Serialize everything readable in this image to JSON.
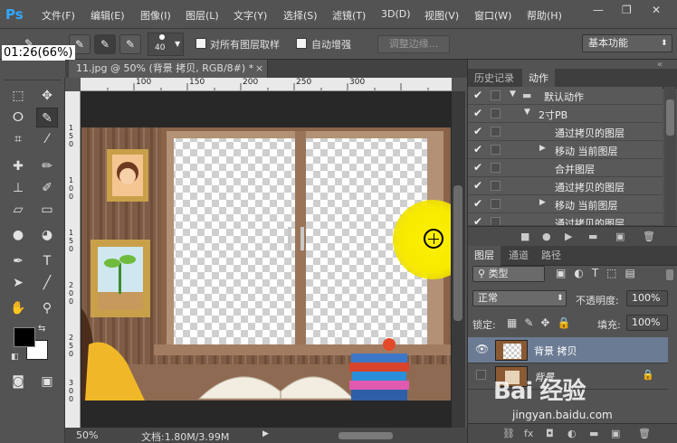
{
  "app": {
    "logo": "Ps"
  },
  "menu": [
    "文件(F)",
    "编辑(E)",
    "图像(I)",
    "图层(L)",
    "文字(Y)",
    "选择(S)",
    "滤镜(T)",
    "3D(D)",
    "视图(V)",
    "窗口(W)",
    "帮助(H)"
  ],
  "window_controls": {
    "minimize": "—",
    "restore": "❐",
    "close": "✕"
  },
  "options": {
    "brush_size": "40",
    "sample_all_layers_label": "对所有图层取样",
    "auto_enhance_label": "自动增强",
    "refine_edge_label": "调整边缘...",
    "workspace": "基本功能"
  },
  "timer": "01:26(66%)",
  "document": {
    "tab_label": "11.jpg @ 50% (背景 拷贝, RGB/8#) *",
    "close": "×",
    "ruler_top_labels": [
      "100",
      "150",
      "200",
      "250",
      "300"
    ],
    "ruler_left_labels": [
      "1",
      "5",
      "0",
      "1",
      "0",
      "0",
      "1",
      "5",
      "0",
      "2",
      "0",
      "0",
      "2",
      "5",
      "0",
      "3",
      "0",
      "0",
      "3",
      "5",
      "0"
    ]
  },
  "status": {
    "zoom": "50%",
    "doc_info": "文档:1.80M/3.99M",
    "arrow": "▶"
  },
  "panels": {
    "top_tabs": [
      "历史记录",
      "动作"
    ],
    "actions": [
      {
        "label": "默认动作",
        "level": 0,
        "expand": "▼",
        "folder": true
      },
      {
        "label": "2寸PB",
        "level": 1,
        "expand": "▼",
        "folder": false
      },
      {
        "label": "通过拷贝的图层",
        "level": 2,
        "expand": "",
        "folder": false
      },
      {
        "label": "移动 当前图层",
        "level": 2,
        "expand": "▶",
        "folder": false
      },
      {
        "label": "合并图层",
        "level": 2,
        "expand": "",
        "folder": false
      },
      {
        "label": "通过拷贝的图层",
        "level": 2,
        "expand": "",
        "folder": false
      },
      {
        "label": "移动 当前图层",
        "level": 2,
        "expand": "▶",
        "folder": false
      },
      {
        "label": "通过拷贝的图层",
        "level": 2,
        "expand": "",
        "folder": false
      }
    ],
    "actions_footer": [
      "■",
      "●",
      "▶",
      "▬",
      "▣",
      "🗑"
    ],
    "layer_tabs": [
      "图层",
      "通道",
      "路径"
    ],
    "filter_kind": "类型",
    "blend_mode": "正常",
    "opacity_label": "不透明度:",
    "opacity_value": "100%",
    "lock_label": "锁定:",
    "fill_label": "填充:",
    "fill_value": "100%",
    "layers": [
      {
        "name": "背景 拷贝",
        "visible": true,
        "selected": true,
        "locked": false
      },
      {
        "name": "背景",
        "visible": false,
        "selected": false,
        "locked": true
      }
    ],
    "layers_footer": [
      "⛓",
      "fx",
      "◘",
      "◐",
      "▬",
      "▣",
      "🗑"
    ]
  },
  "watermark": {
    "logo": "Bai 经验",
    "url": "jingyan.baidu.com"
  },
  "colors": {
    "ui_bg": "#535353",
    "accent": "#31a8ff",
    "selected_layer": "#6b7b93",
    "cursor_highlight": "#f5ec00"
  }
}
